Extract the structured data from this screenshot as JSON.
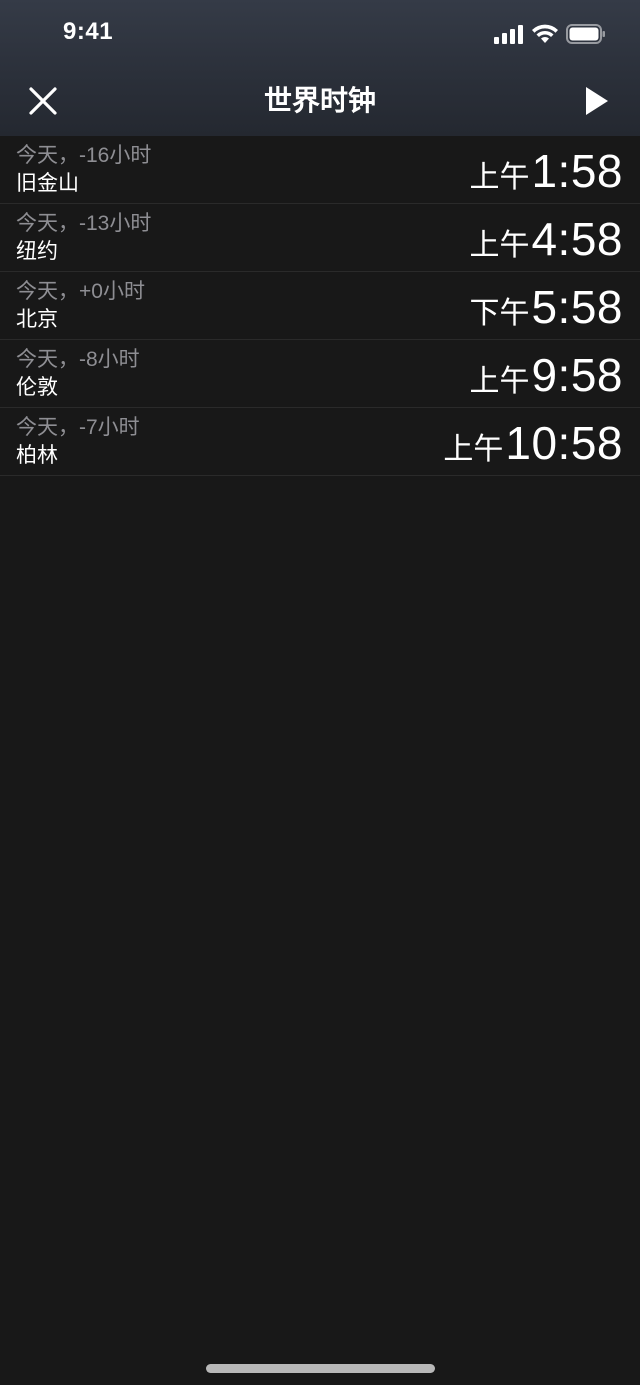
{
  "status_bar": {
    "time": "9:41"
  },
  "nav": {
    "title": "世界时钟",
    "close_icon": "close-icon",
    "play_icon": "play-icon"
  },
  "clocks": [
    {
      "offset": "今天，-16小时",
      "city": "旧金山",
      "ampm": "上午",
      "time": "1:58"
    },
    {
      "offset": "今天，-13小时",
      "city": "纽约",
      "ampm": "上午",
      "time": "4:58"
    },
    {
      "offset": "今天，+0小时",
      "city": "北京",
      "ampm": "下午",
      "time": "5:58"
    },
    {
      "offset": "今天，-8小时",
      "city": "伦敦",
      "ampm": "上午",
      "time": "9:58"
    },
    {
      "offset": "今天，-7小时",
      "city": "柏林",
      "ampm": "上午",
      "time": "10:58"
    }
  ],
  "colors": {
    "background": "#181818",
    "header_top": "#353b47",
    "header_bottom": "#242830",
    "secondary_text": "#8e8e93",
    "separator": "#2a2a2a"
  }
}
